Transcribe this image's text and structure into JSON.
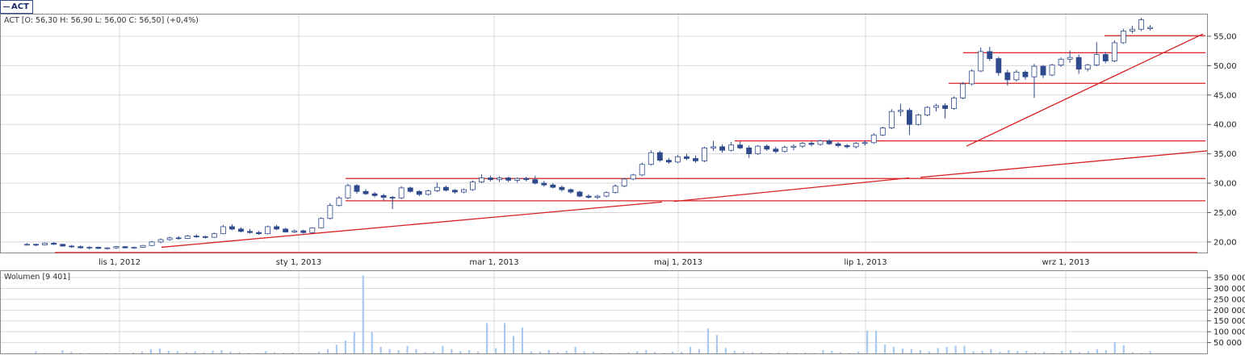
{
  "ticker_tab": {
    "label": "ACT"
  },
  "price_panel": {
    "legend": "ACT [O: 56,30  H: 56,90  L: 56,00  C: 56,50] (+0,4%)",
    "y_ticks": [
      "20,00",
      "25,00",
      "30,00",
      "35,00",
      "40,00",
      "45,00",
      "50,00",
      "55,00"
    ],
    "x_ticks": [
      "lis 1, 2012",
      "sty 1, 2013",
      "mar 1, 2013",
      "maj 1, 2013",
      "lip 1, 2013",
      "wrz 1, 2013"
    ]
  },
  "volume_panel": {
    "legend": "Wolumen [9 401]",
    "y_ticks": [
      "50 000",
      "100 000",
      "150 000",
      "200 000",
      "250 000",
      "300 000",
      "350 000"
    ]
  },
  "colors": {
    "up": "#ffffff",
    "down": "#2e4a8c",
    "wick": "#2e4a8c",
    "trendline": "#d92020",
    "volume": "#a9c9ef",
    "grid": "#d8d8d8"
  },
  "chart_data": [
    {
      "type": "candlestick",
      "title": "ACT",
      "y_range": [
        18.2,
        58.7
      ],
      "x_ticks": [
        "lis 1, 2012",
        "sty 1, 2013",
        "mar 1, 2013",
        "maj 1, 2013",
        "lip 1, 2013",
        "wrz 1, 2013"
      ],
      "series": [
        {
          "values": [
            [
              19.6,
              19.8,
              19.4,
              19.6
            ],
            [
              19.6,
              19.7,
              19.3,
              19.5
            ],
            [
              19.5,
              19.9,
              19.4,
              19.8
            ],
            [
              19.8,
              20.0,
              19.5,
              19.6
            ],
            [
              19.6,
              19.7,
              19.2,
              19.3
            ],
            [
              19.3,
              19.5,
              19.0,
              19.2
            ],
            [
              19.2,
              19.4,
              18.9,
              19.0
            ],
            [
              19.0,
              19.3,
              18.7,
              19.1
            ],
            [
              19.1,
              19.2,
              18.8,
              18.9
            ],
            [
              18.9,
              19.1,
              18.7,
              19.0
            ],
            [
              19.0,
              19.3,
              18.8,
              19.2
            ],
            [
              19.2,
              19.3,
              18.9,
              19.0
            ],
            [
              19.0,
              19.2,
              18.8,
              19.1
            ],
            [
              19.1,
              19.5,
              19.0,
              19.4
            ],
            [
              19.4,
              20.2,
              19.3,
              20.0
            ],
            [
              20.0,
              20.6,
              19.8,
              20.4
            ],
            [
              20.4,
              20.9,
              20.2,
              20.7
            ],
            [
              20.7,
              21.0,
              20.4,
              20.6
            ],
            [
              20.6,
              21.2,
              20.5,
              21.0
            ],
            [
              21.0,
              21.3,
              20.7,
              20.9
            ],
            [
              20.9,
              21.1,
              20.6,
              20.8
            ],
            [
              20.8,
              21.6,
              20.7,
              21.4
            ],
            [
              21.4,
              22.9,
              21.3,
              22.6
            ],
            [
              22.6,
              23.0,
              22.0,
              22.2
            ],
            [
              22.2,
              22.5,
              21.6,
              21.8
            ],
            [
              21.8,
              22.2,
              21.4,
              21.6
            ],
            [
              21.6,
              21.9,
              21.2,
              21.4
            ],
            [
              21.4,
              22.8,
              21.3,
              22.6
            ],
            [
              22.6,
              22.9,
              22.0,
              22.2
            ],
            [
              22.2,
              22.4,
              21.6,
              21.7
            ],
            [
              21.7,
              22.1,
              21.5,
              21.9
            ],
            [
              21.9,
              22.1,
              21.4,
              21.6
            ],
            [
              21.6,
              22.5,
              21.5,
              22.4
            ],
            [
              22.4,
              24.2,
              22.3,
              24.0
            ],
            [
              24.0,
              26.6,
              23.8,
              26.2
            ],
            [
              26.2,
              27.8,
              26.0,
              27.5
            ],
            [
              27.5,
              29.9,
              27.3,
              29.6
            ],
            [
              29.6,
              29.8,
              28.2,
              28.6
            ],
            [
              28.6,
              29.0,
              28.0,
              28.2
            ],
            [
              28.2,
              28.5,
              27.6,
              27.9
            ],
            [
              27.9,
              28.2,
              27.0,
              27.6
            ],
            [
              27.6,
              27.8,
              25.6,
              27.5
            ],
            [
              27.5,
              29.5,
              27.3,
              29.2
            ],
            [
              29.2,
              29.4,
              28.4,
              28.6
            ],
            [
              28.6,
              28.8,
              27.8,
              28.1
            ],
            [
              28.1,
              28.9,
              27.9,
              28.7
            ],
            [
              28.7,
              30.1,
              28.5,
              29.3
            ],
            [
              29.3,
              29.6,
              28.6,
              28.8
            ],
            [
              28.8,
              29.0,
              28.2,
              28.5
            ],
            [
              28.5,
              29.1,
              28.3,
              28.9
            ],
            [
              28.9,
              30.5,
              28.7,
              30.2
            ],
            [
              30.2,
              31.5,
              30.0,
              30.9
            ],
            [
              30.9,
              31.3,
              30.3,
              30.6
            ],
            [
              30.6,
              31.2,
              30.2,
              30.9
            ],
            [
              30.9,
              31.1,
              30.2,
              30.5
            ],
            [
              30.5,
              31.0,
              30.1,
              30.8
            ],
            [
              30.8,
              31.1,
              30.3,
              30.6
            ],
            [
              30.6,
              31.3,
              29.8,
              30.0
            ],
            [
              30.0,
              30.4,
              29.4,
              29.7
            ],
            [
              29.7,
              30.0,
              29.1,
              29.3
            ],
            [
              29.3,
              29.6,
              28.6,
              28.9
            ],
            [
              28.9,
              29.1,
              28.2,
              28.5
            ],
            [
              28.5,
              28.7,
              27.6,
              27.8
            ],
            [
              27.8,
              28.1,
              27.4,
              27.6
            ],
            [
              27.6,
              28.0,
              27.3,
              27.8
            ],
            [
              27.8,
              28.6,
              27.6,
              28.4
            ],
            [
              28.4,
              29.8,
              28.2,
              29.5
            ],
            [
              29.5,
              30.9,
              29.3,
              30.7
            ],
            [
              30.7,
              31.6,
              30.5,
              31.4
            ],
            [
              31.4,
              33.5,
              31.2,
              33.2
            ],
            [
              33.2,
              35.6,
              33.0,
              35.2
            ],
            [
              35.2,
              35.5,
              33.6,
              33.9
            ],
            [
              33.9,
              34.3,
              33.3,
              33.6
            ],
            [
              33.6,
              34.8,
              33.4,
              34.5
            ],
            [
              34.5,
              35.0,
              33.9,
              34.2
            ],
            [
              34.2,
              34.7,
              33.5,
              33.8
            ],
            [
              33.8,
              36.2,
              33.6,
              36.0
            ],
            [
              36.0,
              37.2,
              35.5,
              36.2
            ],
            [
              36.2,
              36.6,
              35.2,
              35.6
            ],
            [
              35.6,
              37.0,
              35.4,
              36.5
            ],
            [
              36.5,
              37.1,
              35.8,
              36.0
            ],
            [
              36.0,
              36.4,
              34.3,
              35.0
            ],
            [
              35.0,
              36.5,
              34.8,
              36.3
            ],
            [
              36.3,
              36.6,
              35.5,
              35.8
            ],
            [
              35.8,
              36.2,
              35.1,
              35.4
            ],
            [
              35.4,
              36.4,
              35.2,
              36.1
            ],
            [
              36.1,
              36.6,
              35.6,
              36.3
            ],
            [
              36.3,
              37.0,
              36.0,
              36.8
            ],
            [
              36.8,
              37.1,
              36.3,
              36.6
            ],
            [
              36.6,
              37.4,
              36.4,
              37.2
            ],
            [
              37.2,
              37.5,
              36.5,
              36.7
            ],
            [
              36.7,
              37.0,
              36.1,
              36.4
            ],
            [
              36.4,
              36.7,
              35.9,
              36.2
            ],
            [
              36.2,
              37.0,
              35.9,
              36.8
            ],
            [
              36.8,
              37.3,
              36.4,
              36.9
            ],
            [
              36.9,
              38.5,
              36.7,
              38.2
            ],
            [
              38.2,
              39.6,
              38.0,
              39.4
            ],
            [
              39.4,
              42.6,
              39.2,
              42.2
            ],
            [
              42.2,
              43.5,
              41.4,
              42.4
            ],
            [
              42.4,
              42.8,
              38.2,
              40.0
            ],
            [
              40.0,
              41.8,
              39.8,
              41.6
            ],
            [
              41.6,
              43.1,
              41.4,
              42.9
            ],
            [
              42.9,
              43.5,
              42.2,
              43.2
            ],
            [
              43.2,
              43.6,
              41.0,
              42.7
            ],
            [
              42.7,
              44.8,
              42.5,
              44.5
            ],
            [
              44.5,
              47.2,
              44.3,
              46.9
            ],
            [
              46.9,
              49.4,
              46.6,
              49.1
            ],
            [
              49.1,
              53.1,
              48.9,
              52.4
            ],
            [
              52.4,
              53.2,
              50.8,
              51.2
            ],
            [
              51.2,
              51.5,
              48.3,
              48.8
            ],
            [
              48.8,
              49.3,
              46.6,
              47.6
            ],
            [
              47.6,
              49.3,
              47.3,
              48.9
            ],
            [
              48.9,
              49.2,
              47.6,
              48.1
            ],
            [
              48.1,
              50.3,
              44.5,
              49.9
            ],
            [
              49.9,
              50.1,
              47.9,
              48.4
            ],
            [
              48.4,
              50.3,
              48.2,
              50.1
            ],
            [
              50.1,
              51.4,
              49.8,
              51.1
            ],
            [
              51.1,
              52.6,
              50.5,
              51.4
            ],
            [
              51.4,
              51.9,
              48.6,
              49.4
            ],
            [
              49.4,
              50.3,
              49.0,
              50.1
            ],
            [
              50.1,
              54.0,
              49.9,
              51.9
            ],
            [
              51.9,
              52.3,
              50.4,
              50.8
            ],
            [
              50.8,
              54.3,
              50.6,
              53.9
            ],
            [
              53.9,
              56.3,
              53.7,
              55.9
            ],
            [
              55.9,
              56.8,
              55.5,
              56.2
            ],
            [
              56.2,
              58.1,
              55.9,
              57.8
            ],
            [
              56.3,
              56.9,
              56.0,
              56.5
            ]
          ]
        }
      ]
    },
    {
      "type": "bar",
      "title": "Wolumen",
      "y_range": [
        0,
        380000
      ],
      "values": [
        1000,
        9000,
        2000,
        1000,
        14000,
        8000,
        3000,
        2000,
        1000,
        3000,
        2000,
        1000,
        4000,
        10000,
        20000,
        22000,
        12000,
        10000,
        5000,
        9000,
        4000,
        12000,
        15000,
        8000,
        6000,
        3000,
        2000,
        10000,
        5000,
        3000,
        4000,
        3000,
        2000,
        8000,
        20000,
        40000,
        60000,
        100000,
        360000,
        100000,
        30000,
        20000,
        15000,
        35000,
        20000,
        6000,
        8000,
        35000,
        20000,
        10000,
        15000,
        9000,
        140000,
        24000,
        140000,
        80000,
        120000,
        9000,
        8000,
        15000,
        6000,
        12000,
        30000,
        9000,
        8000,
        4000,
        3000,
        2000,
        5000,
        10000,
        15000,
        7000,
        3000,
        8000,
        7000,
        30000,
        20000,
        115000,
        85000,
        25000,
        12000,
        8000,
        6000,
        5000,
        3000,
        4000,
        6000,
        3000,
        4000,
        3000,
        15000,
        12000,
        5000,
        3000,
        8000,
        106000,
        106000,
        40000,
        30000,
        22000,
        20000,
        15000,
        9000,
        25000,
        30000,
        35000,
        35000,
        10000,
        12000,
        20000,
        8000,
        15000,
        10000,
        12000,
        5000,
        8000,
        3000,
        12000,
        15000,
        6000,
        9000,
        20000,
        14000,
        52000,
        38000,
        5000,
        3000,
        10000
      ]
    }
  ]
}
